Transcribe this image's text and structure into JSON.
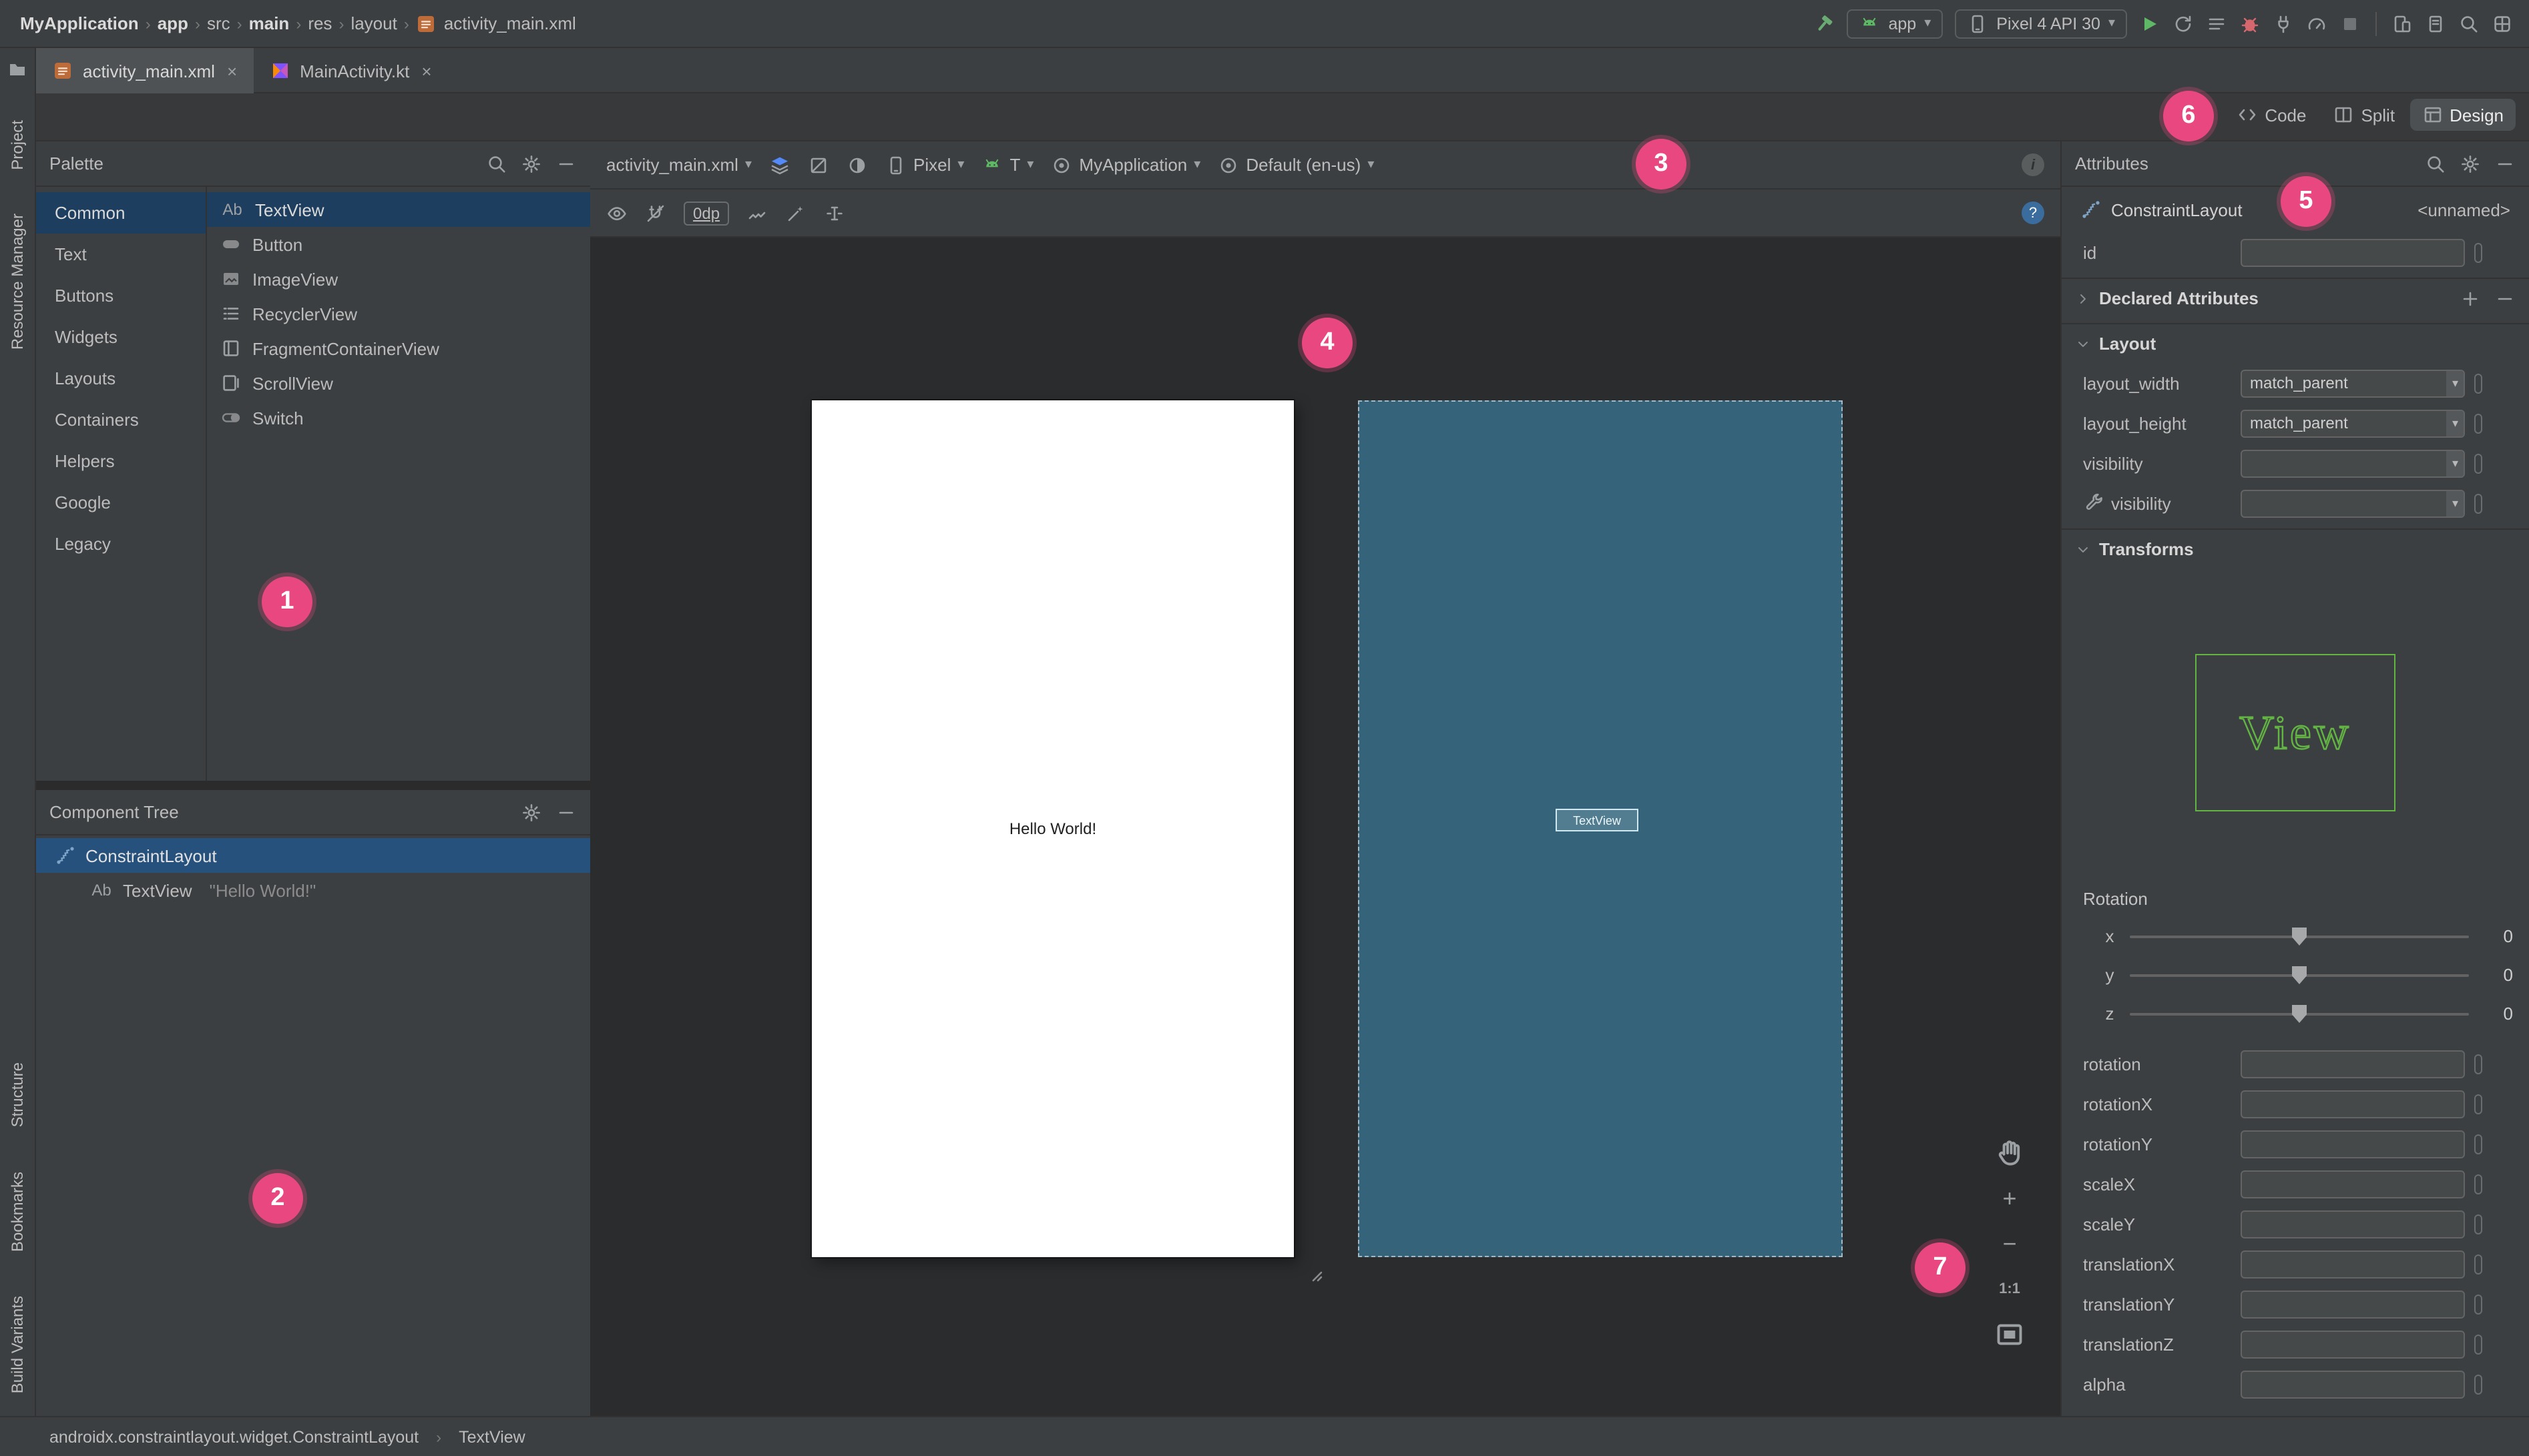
{
  "window": {
    "breadcrumb": [
      {
        "label": "MyApplication",
        "bold": true
      },
      {
        "label": "app",
        "bold": true
      },
      {
        "label": "src",
        "bold": false
      },
      {
        "label": "main",
        "bold": true
      },
      {
        "label": "res",
        "bold": false
      },
      {
        "label": "layout",
        "bold": false
      },
      {
        "label": "activity_main.xml",
        "bold": false,
        "icon": "xmlfile"
      }
    ],
    "run_config": "app",
    "device": "Pixel 4 API 30"
  },
  "tabs": [
    {
      "label": "activity_main.xml",
      "icon": "xmlfile",
      "active": true
    },
    {
      "label": "MainActivity.kt",
      "icon": "kotlinfile",
      "active": false
    }
  ],
  "view_modes": {
    "options": [
      "Code",
      "Split",
      "Design"
    ],
    "active": "Design"
  },
  "left_rail": {
    "top": [
      "Project",
      "Resource Manager"
    ],
    "bottom": [
      "Structure",
      "Bookmarks",
      "Build Variants"
    ]
  },
  "palette": {
    "title": "Palette",
    "categories": [
      "Common",
      "Text",
      "Buttons",
      "Widgets",
      "Layouts",
      "Containers",
      "Helpers",
      "Google",
      "Legacy"
    ],
    "selected_category": "Common",
    "selected_component": "TextView",
    "components": [
      {
        "label": "TextView",
        "icon": "ab",
        "icon_text": "Ab"
      },
      {
        "label": "Button",
        "icon": "buttoncomp"
      },
      {
        "label": "ImageView",
        "icon": "imagecomp"
      },
      {
        "label": "RecyclerView",
        "icon": "recycler"
      },
      {
        "label": "FragmentContainerView",
        "icon": "fragment"
      },
      {
        "label": "ScrollView",
        "icon": "scrollcomp"
      },
      {
        "label": "Switch",
        "icon": "switchcomp"
      }
    ]
  },
  "component_tree": {
    "title": "Component Tree",
    "items": [
      {
        "label": "ConstraintLayout",
        "icon": "constraintlayout",
        "selected": true,
        "indent": 0,
        "detail": ""
      },
      {
        "label": "TextView",
        "icon": "ab",
        "icon_text": "Ab",
        "selected": false,
        "indent": 1,
        "detail": "\"Hello World!\""
      }
    ]
  },
  "design_toolbar": {
    "file": "activity_main.xml",
    "device": "Pixel",
    "api": "T",
    "theme": "MyApplication",
    "locale": "Default (en-us)",
    "margin": "0dp"
  },
  "canvas": {
    "design_text": "Hello World!",
    "blueprint_label": "TextView",
    "zoom_label": "1:1"
  },
  "attributes": {
    "title": "Attributes",
    "component": "ConstraintLayout",
    "component_id": "<unnamed>",
    "id_label": "id",
    "id_value": "",
    "declared_section": "Declared Attributes",
    "layout_section": "Layout",
    "transforms_section": "Transforms",
    "layout_rows": [
      {
        "label": "layout_width",
        "value": "match_parent",
        "tools": false
      },
      {
        "label": "layout_height",
        "value": "match_parent",
        "tools": false
      },
      {
        "label": "visibility",
        "value": "",
        "tools": false
      },
      {
        "label": "visibility",
        "value": "",
        "tools": true
      }
    ],
    "preview_text": "View",
    "rotation_label": "Rotation",
    "sliders": [
      {
        "axis": "x",
        "value": "0"
      },
      {
        "axis": "y",
        "value": "0"
      },
      {
        "axis": "z",
        "value": "0"
      }
    ],
    "fields": [
      "rotation",
      "rotationX",
      "rotationY",
      "scaleX",
      "scaleY",
      "translationX",
      "translationY",
      "translationZ",
      "alpha"
    ]
  },
  "status_bar": {
    "items": [
      "androidx.constraintlayout.widget.ConstraintLayout",
      "TextView"
    ]
  },
  "annotations": {
    "badges": [
      "1",
      "2",
      "3",
      "4",
      "5",
      "6",
      "7"
    ]
  },
  "colors": {
    "annotation_pink": "#e8487f",
    "blueprint_teal": "#35647a",
    "selection_blue": "#26517c",
    "accent_green": "#62b543",
    "panel_bg": "#3c3f41"
  }
}
